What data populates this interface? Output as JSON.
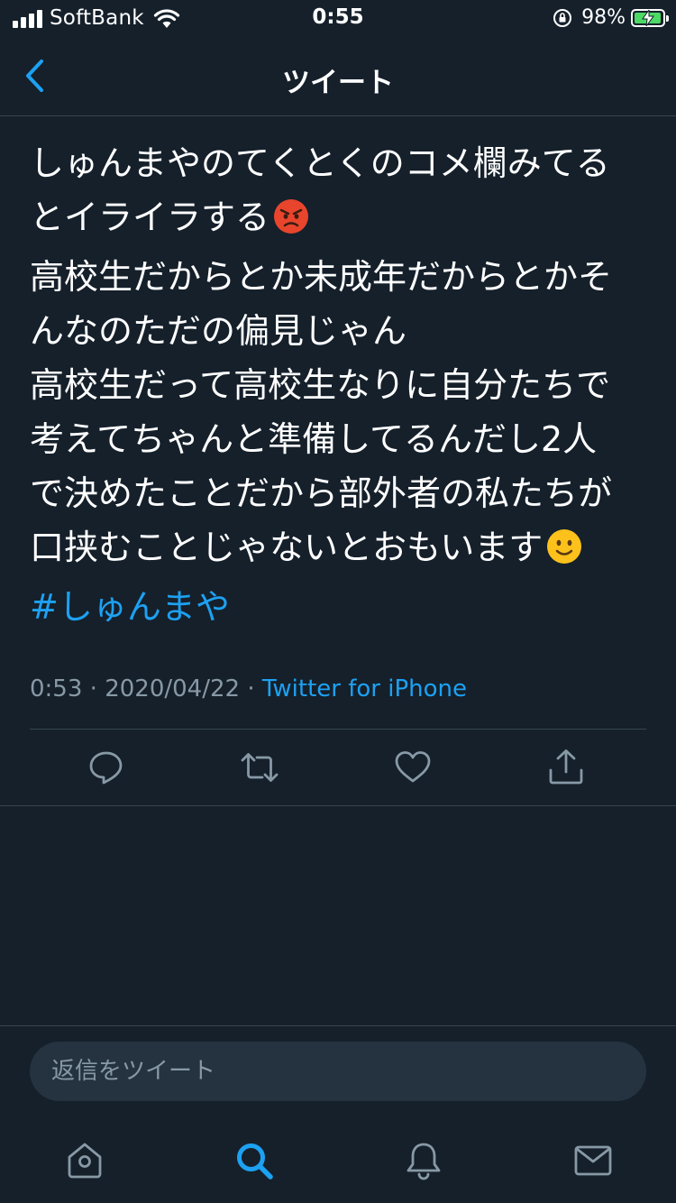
{
  "status_bar": {
    "carrier": "SoftBank",
    "time": "0:55",
    "battery": "98%",
    "battery_level": 0.98
  },
  "header": {
    "title": "ツイート",
    "back_icon": "chevron-left-icon"
  },
  "tweet": {
    "text": "しゅんまやのてくとくのコメ欄みてるとイライラする😡\n高校生だからとか未成年だからとかそんなのただの偏見じゃん\n高校生だって高校生なりに自分たちで考えてちゃんと準備してるんだし2人で決めたことだから部外者の私たちが口挟むことじゃないとおもいます🙂",
    "line1": "しゅんまやのてくとくのコメ欄みてる",
    "line2": "とイライラする",
    "line3": "高校生だからとか未成年だからとかそ",
    "line4": "んなのただの偏見じゃん",
    "line5": "高校生だって高校生なりに自分たちで",
    "line6": "考えてちゃんと準備してるんだし2人",
    "line7": "で決めたことだから部外者の私たちが",
    "line8": "口挟むことじゃないとおもいます",
    "emoji_1": "angry-face-emoji",
    "emoji_2": "slightly-smiling-face-emoji",
    "hashtag": "#しゅんまや",
    "time": "0:53",
    "date": "2020/04/22",
    "separator": "·",
    "source": "Twitter for iPhone"
  },
  "actions": [
    {
      "name": "reply",
      "icon": "reply-icon"
    },
    {
      "name": "retweet",
      "icon": "retweet-icon"
    },
    {
      "name": "like",
      "icon": "heart-icon"
    },
    {
      "name": "share",
      "icon": "share-icon"
    }
  ],
  "reply": {
    "placeholder": "返信をツイート"
  },
  "tab_bar": [
    {
      "name": "home",
      "icon": "home-icon",
      "active": false
    },
    {
      "name": "search",
      "icon": "search-icon",
      "active": true
    },
    {
      "name": "notifications",
      "icon": "bell-icon",
      "active": false
    },
    {
      "name": "messages",
      "icon": "mail-icon",
      "active": false
    }
  ],
  "colors": {
    "background": "#15202b",
    "accent": "#1da1f2",
    "muted": "#8899a6",
    "border": "#38444d"
  }
}
